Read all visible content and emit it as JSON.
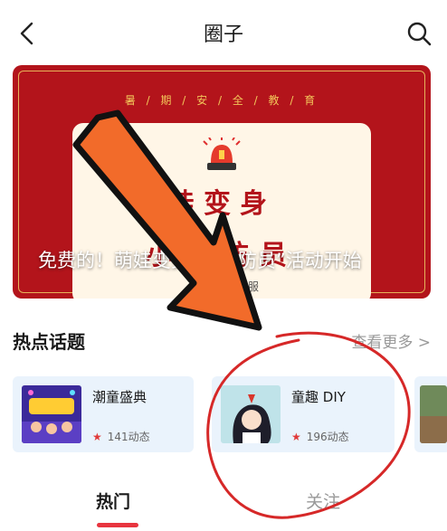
{
  "header": {
    "title": "圈子",
    "back_icon": "back-arrow-icon",
    "search_icon": "search-icon"
  },
  "banner": {
    "edu_text": "暑 / 期 / 安 / 全 / 教 / 育",
    "line1": "娃变身",
    "line2": "小消防员",
    "caption": "免费的！萌娃变身“小消防员”活动开始",
    "small_text": "制服"
  },
  "hot_topics": {
    "heading": "热点话题",
    "more_label": "查看更多 >",
    "items": [
      {
        "name": "潮童盛典",
        "count": "141动态"
      },
      {
        "name": "童趣 DIY",
        "count": "196动态"
      }
    ]
  },
  "tabs": [
    {
      "label": "热门",
      "active": true
    },
    {
      "label": "关注",
      "active": false
    }
  ],
  "colors": {
    "banner_red": "#b3141b",
    "accent_red": "#e8343f",
    "annotation_orange": "#f26b2a",
    "topic_bg": "#eaf3fc"
  }
}
